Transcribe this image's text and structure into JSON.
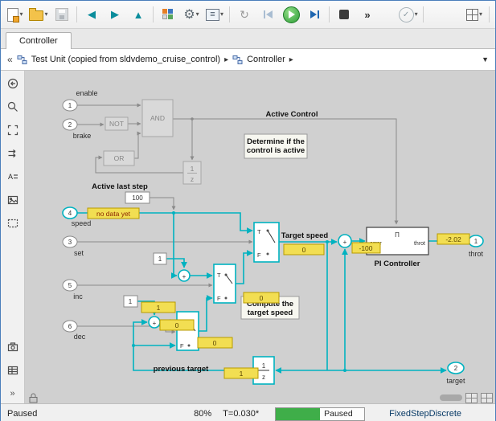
{
  "icons": {
    "caret": "▾",
    "back": "◀",
    "forward": "▶",
    "up": "▲",
    "gear": "⚙",
    "menu": "≡",
    "restart": "↻",
    "check": "✓",
    "overflow": "»",
    "annotation": "A",
    "more": "»",
    "crumb_back": "«",
    "crumb_sep": "▸",
    "crumb_drop": "▼"
  },
  "tab": {
    "label": "Controller"
  },
  "breadcrumb": {
    "items": [
      {
        "label": "Test Unit (copied from sldvdemo_cruise_control)"
      },
      {
        "label": "Controller"
      }
    ]
  },
  "canvas": {
    "inports": [
      {
        "num": "1",
        "label": "enable"
      },
      {
        "num": "2",
        "label": "brake"
      },
      {
        "num": "4",
        "label": "speed"
      },
      {
        "num": "3",
        "label": "set"
      },
      {
        "num": "5",
        "label": "inc"
      },
      {
        "num": "6",
        "label": "dec"
      }
    ],
    "outports": [
      {
        "num": "1",
        "label": "throt"
      },
      {
        "num": "2",
        "label": "target"
      }
    ],
    "logic": {
      "not": "NOT",
      "and": "AND",
      "or": "OR"
    },
    "constants": {
      "c100": "100",
      "c1a": "1",
      "c1b": "1"
    },
    "delay": {
      "num": "1",
      "den": "z"
    },
    "sw": {
      "t": "T",
      "f": "F"
    },
    "sum": {
      "plus": "+"
    },
    "pi": {
      "glyph": "Π",
      "in": "error",
      "out": "throt",
      "label": "PI Controller"
    },
    "labels": {
      "active_control": "Active Control",
      "active_last_step": "Active last step",
      "target_speed": "Target speed",
      "previous_target": "previous target",
      "note1_line1": "Determine if the",
      "note1_line2": "control is active",
      "note2_line1": "Compute the",
      "note2_line2": "target speed"
    },
    "badges": {
      "no_data": "no data yet",
      "target": "0",
      "pi_in": "-100",
      "pi_out": "-2.02",
      "one_inc": "1",
      "zero_sum": "0",
      "zero_sw3": "0",
      "zero_sw2": "0",
      "prev": "1"
    }
  },
  "statusbar": {
    "state": "Paused",
    "zoom": "80%",
    "time": "T=0.030*",
    "progress_label": "Paused",
    "solver": "FixedStepDiscrete"
  }
}
